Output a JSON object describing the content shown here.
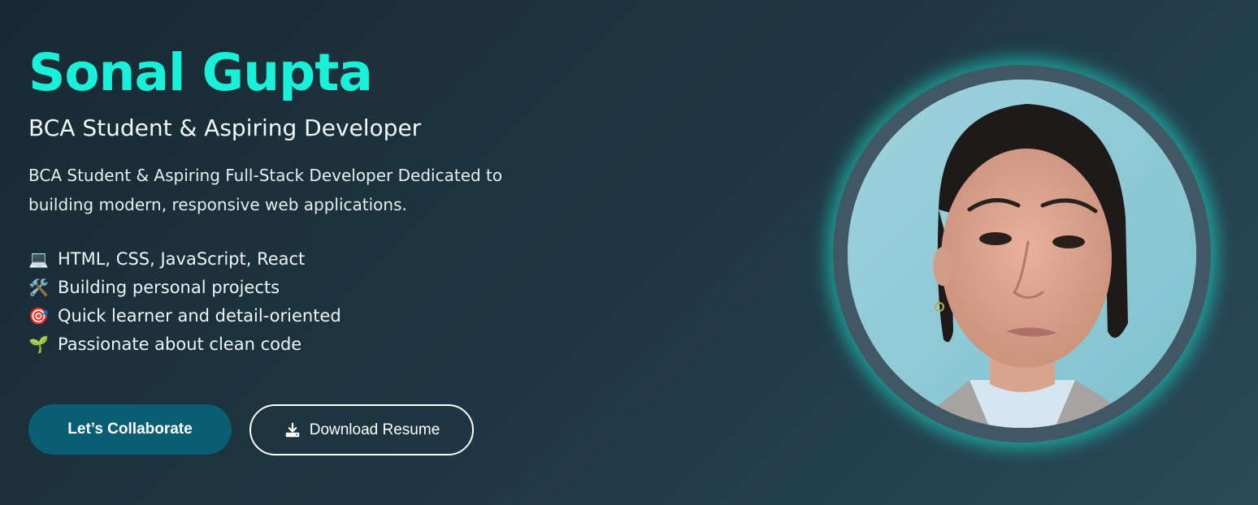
{
  "hero": {
    "name": "Sonal Gupta",
    "role": "BCA Student & Aspiring Developer",
    "description": "BCA Student & Aspiring Full-Stack Developer Dedicated to building modern, responsive web applications.",
    "highlights": [
      {
        "icon": "laptop-icon",
        "emoji": "💻",
        "text": "HTML, CSS, JavaScript, React"
      },
      {
        "icon": "tools-icon",
        "emoji": "🛠️",
        "text": "Building personal projects"
      },
      {
        "icon": "target-icon",
        "emoji": "🎯",
        "text": "Quick learner and detail-oriented"
      },
      {
        "icon": "seedling-icon",
        "emoji": "🌱",
        "text": "Passionate about clean code"
      }
    ],
    "buttons": {
      "collaborate_label": "Let’s Collaborate",
      "resume_label": "Download Resume",
      "resume_icon": "download-icon"
    },
    "profile_image_alt": "profile photo",
    "colors": {
      "accent": "#19f0d8",
      "button_primary": "#0a5d72",
      "background_start": "#172a33",
      "background_end": "#2a4a5a"
    }
  }
}
